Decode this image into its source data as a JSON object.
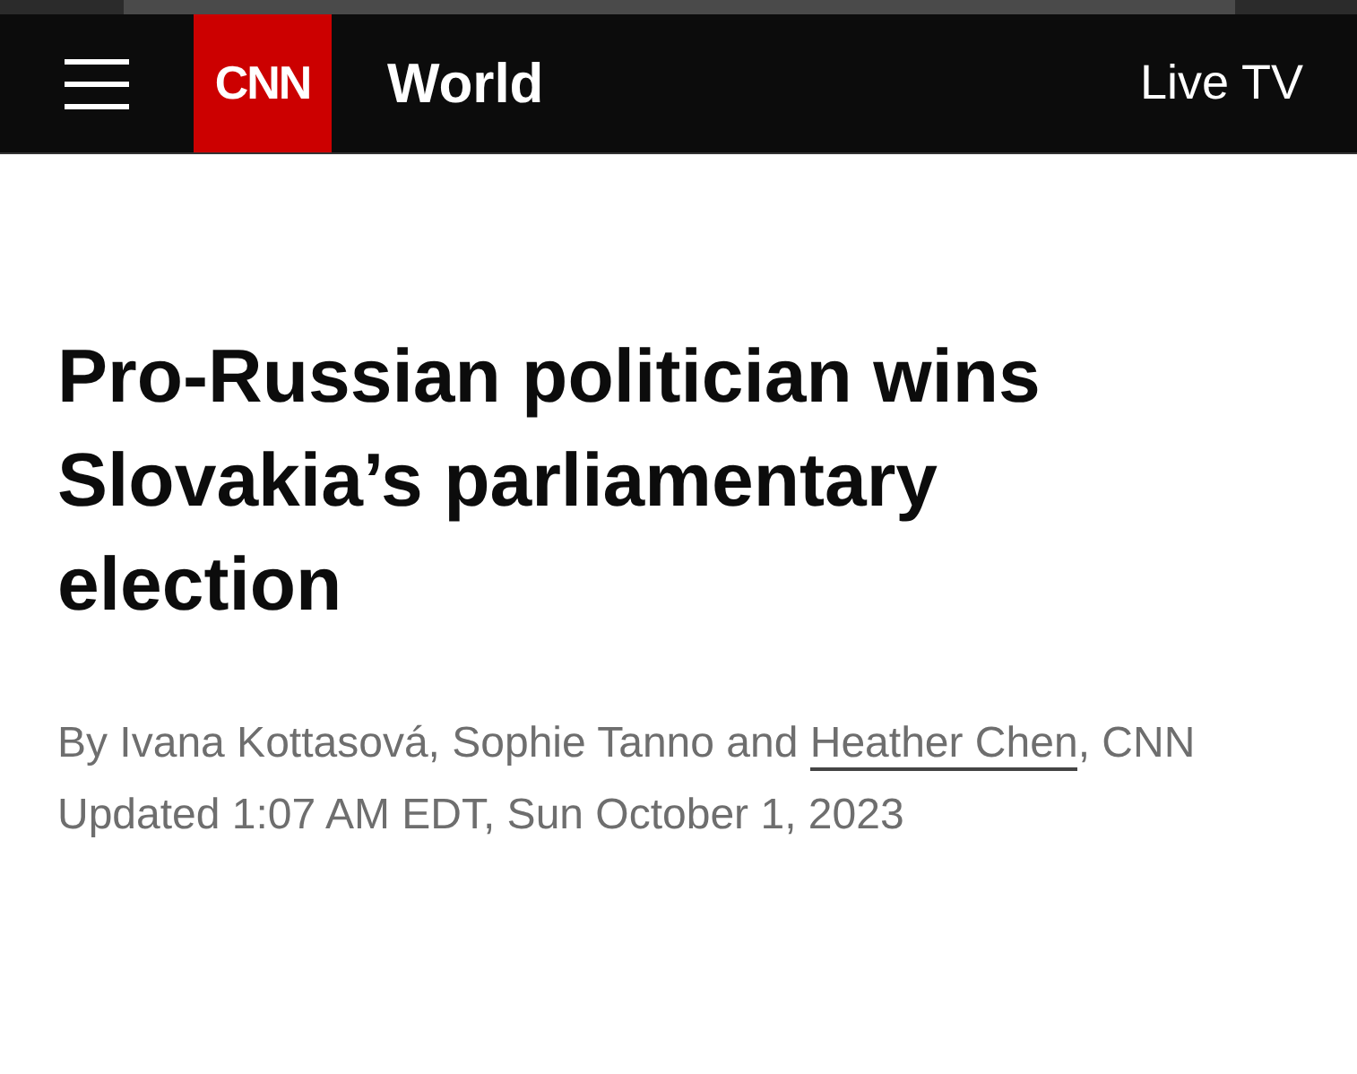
{
  "header": {
    "logo": "CNN",
    "section": "World",
    "live_link": "Live TV"
  },
  "article": {
    "headline": "Pro-Russian politician wins Slovakia’s parliamentary election",
    "byline": {
      "text_before": "By Ivana Kottasová, Sophie Tanno and",
      "link": "Heather Chen",
      "text_after": ", CNN"
    },
    "updated": "Updated 1:07 AM EDT, Sun October 1, 2023"
  }
}
